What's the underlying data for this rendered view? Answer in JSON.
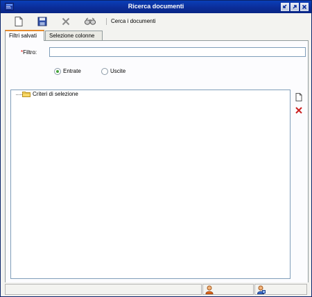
{
  "window": {
    "title": "Ricerca documenti",
    "colors": {
      "title_bar": "#0b2d99",
      "active_tab_accent": "#e68b2c",
      "required_mark": "#e00000",
      "delete_red": "#cc2020"
    }
  },
  "toolbar": {
    "icons": [
      "new-document-icon",
      "save-icon",
      "delete-icon",
      "search-binoculars-icon"
    ],
    "search_label": "Cerca i documenti"
  },
  "tabs": [
    {
      "label": "Filtri salvati",
      "active": true
    },
    {
      "label": "Selezione colonne",
      "active": false
    }
  ],
  "filter": {
    "required_mark": "*",
    "label": "Filtro:",
    "value": ""
  },
  "direction": {
    "options": [
      {
        "label": "Entrate",
        "selected": true
      },
      {
        "label": "Uscite",
        "selected": false
      }
    ]
  },
  "tree": {
    "root_label": "Criteri di selezione"
  },
  "side_actions": [
    "new-item-icon",
    "delete-item-icon"
  ],
  "statusbar": {
    "main_text": "",
    "user_icons": [
      "user-icon",
      "user-group-icon"
    ]
  }
}
